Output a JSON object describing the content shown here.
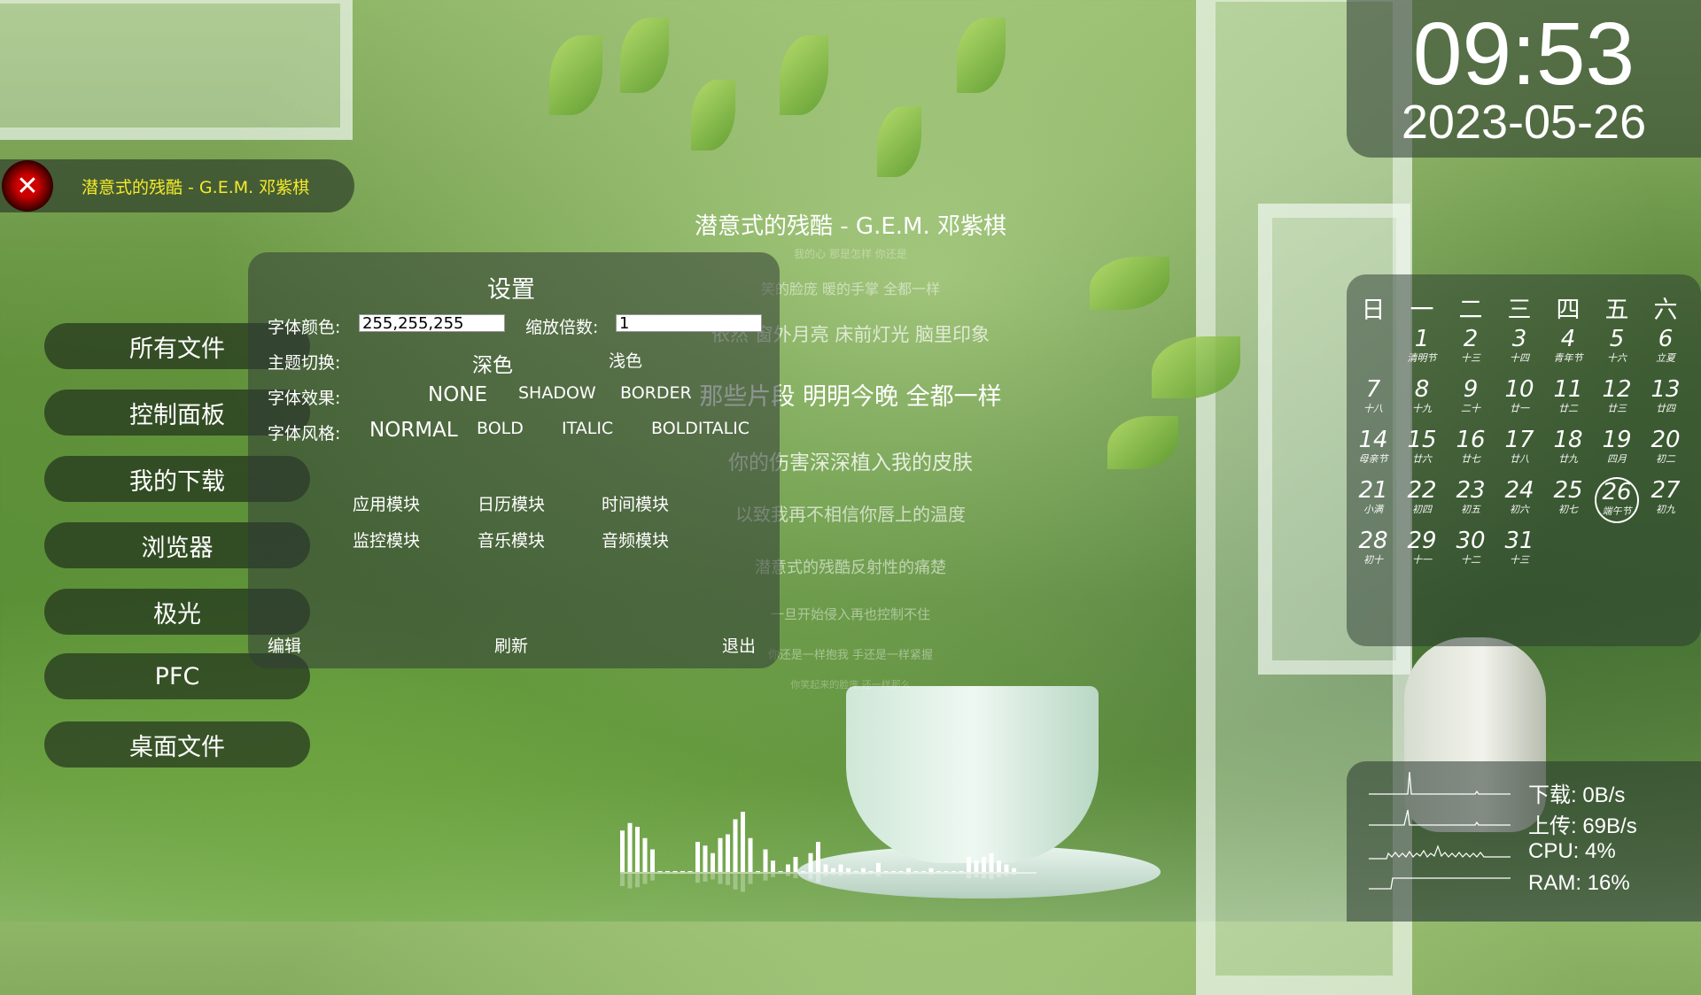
{
  "sidebar": {
    "now_playing": {
      "icon": "x-mark-icon",
      "title": "潜意式的残酷 - G.E.M. 邓紫棋"
    },
    "items": [
      "所有文件",
      "控制面板",
      "我的下载",
      "浏览器",
      "极光",
      "PFC",
      "桌面文件"
    ]
  },
  "settings": {
    "title": "设置",
    "font_color_label": "字体颜色:",
    "font_color_value": "255,255,255",
    "zoom_label": "缩放倍数:",
    "zoom_value": "1",
    "theme_label": "主题切换:",
    "theme_dark": "深色",
    "theme_light": "浅色",
    "effect_label": "字体效果:",
    "effects": [
      "NONE",
      "SHADOW",
      "BORDER"
    ],
    "style_label": "字体风格:",
    "styles": [
      "NORMAL",
      "BOLD",
      "ITALIC",
      "BOLDITALIC"
    ],
    "modules_row1": [
      "应用模块",
      "日历模块",
      "时间模块"
    ],
    "modules_row2": [
      "监控模块",
      "音乐模块",
      "音频模块"
    ],
    "edit": "编辑",
    "refresh": "刷新",
    "exit": "退出"
  },
  "lyrics": {
    "title": "潜意式的残酷 - G.E.M. 邓紫棋",
    "lines": [
      "我的心 那是怎样 你还是",
      "笑的脸庞 暖的手掌 全都一样",
      "依然 窗外月亮 床前灯光 脑里印象",
      "那些片段 明明今晚 全都一样",
      "你的伤害深深植入我的皮肤",
      "以致我再不相信你唇上的温度",
      "潜意式的残酷反射性的痛楚",
      "一旦开始侵入再也控制不住",
      "你还是一样抱我 手还是一样紧握",
      "你笑起来的脸庞 还一样那么"
    ]
  },
  "clock": {
    "time": "09:53",
    "date": "2023-05-26"
  },
  "calendar": {
    "weekdays": [
      "日",
      "一",
      "二",
      "三",
      "四",
      "五",
      "六"
    ],
    "today": "26",
    "days": [
      {
        "d": "1",
        "l": "清明节"
      },
      {
        "d": "2",
        "l": "十三"
      },
      {
        "d": "3",
        "l": "十四"
      },
      {
        "d": "4",
        "l": "青年节"
      },
      {
        "d": "5",
        "l": "十六"
      },
      {
        "d": "6",
        "l": "立夏"
      },
      {
        "d": "7",
        "l": "十八"
      },
      {
        "d": "8",
        "l": "十九"
      },
      {
        "d": "9",
        "l": "二十"
      },
      {
        "d": "10",
        "l": "廿一"
      },
      {
        "d": "11",
        "l": "廿二"
      },
      {
        "d": "12",
        "l": "廿三"
      },
      {
        "d": "13",
        "l": "廿四"
      },
      {
        "d": "14",
        "l": "母亲节"
      },
      {
        "d": "15",
        "l": "廿六"
      },
      {
        "d": "16",
        "l": "廿七"
      },
      {
        "d": "17",
        "l": "廿八"
      },
      {
        "d": "18",
        "l": "廿九"
      },
      {
        "d": "19",
        "l": "四月"
      },
      {
        "d": "20",
        "l": "初二"
      },
      {
        "d": "21",
        "l": "小满"
      },
      {
        "d": "22",
        "l": "初四"
      },
      {
        "d": "23",
        "l": "初五"
      },
      {
        "d": "24",
        "l": "初六"
      },
      {
        "d": "25",
        "l": "初七"
      },
      {
        "d": "26",
        "l": "端午节"
      },
      {
        "d": "27",
        "l": "初九"
      },
      {
        "d": "28",
        "l": "初十"
      },
      {
        "d": "29",
        "l": "十一"
      },
      {
        "d": "30",
        "l": "十二"
      },
      {
        "d": "31",
        "l": "十三"
      }
    ]
  },
  "monitor": {
    "download": "下载: 0B/s",
    "upload": "上传: 69B/s",
    "cpu": "CPU: 4%",
    "ram": "RAM: 16%"
  },
  "spectrum": [
    0.55,
    0.65,
    0.6,
    0.45,
    0.3,
    0,
    0,
    0,
    0,
    0,
    0.4,
    0.35,
    0.25,
    0.45,
    0.5,
    0.7,
    0.8,
    0.45,
    0,
    0.3,
    0.15,
    0,
    0.1,
    0.2,
    0,
    0.25,
    0.4,
    0.1,
    0.05,
    0.1,
    0.05,
    0,
    0.05,
    0,
    0.12,
    0,
    0,
    0,
    0.05,
    0,
    0,
    0.05,
    0,
    0,
    0,
    0,
    0.2,
    0.15,
    0.2,
    0.25,
    0.15,
    0.1,
    0.05
  ]
}
